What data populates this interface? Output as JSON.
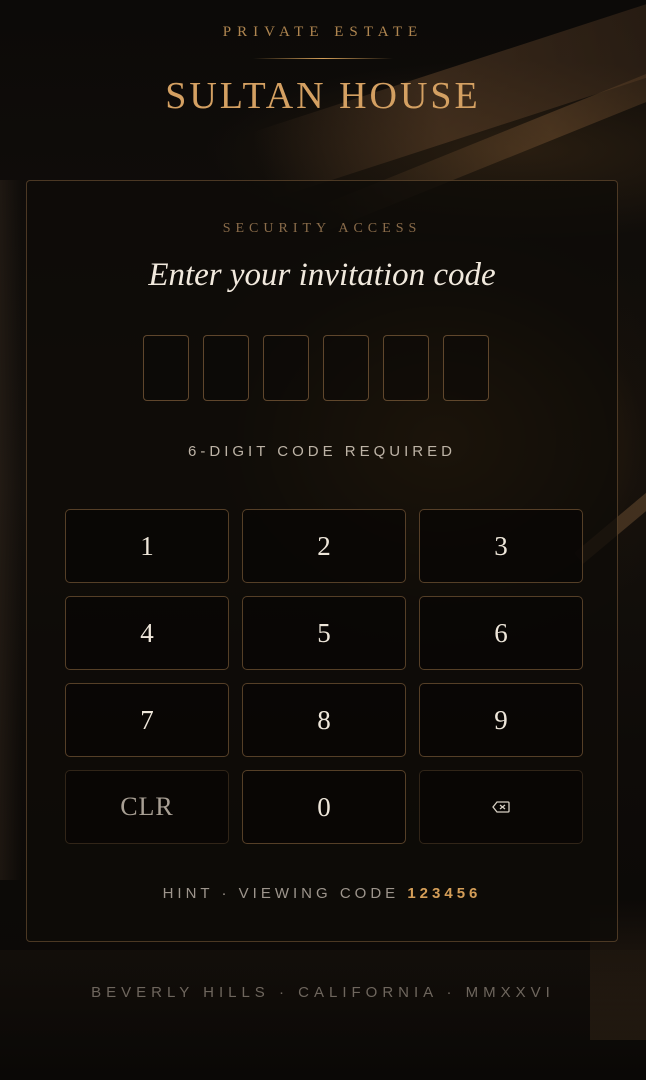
{
  "header": {
    "eyebrow": "PRIVATE ESTATE",
    "brand": "SULTAN HOUSE"
  },
  "card": {
    "eyebrow": "SECURITY ACCESS",
    "title": "Enter your invitation code",
    "code_slots": [
      "",
      "",
      "",
      "",
      "",
      ""
    ],
    "code_note": "6-DIGIT CODE REQUIRED"
  },
  "keypad": {
    "keys": [
      "1",
      "2",
      "3",
      "4",
      "5",
      "6",
      "7",
      "8",
      "9",
      "CLR",
      "0"
    ],
    "backspace_icon": "backspace-icon"
  },
  "hint": {
    "label": "HINT · VIEWING CODE",
    "code": "123456"
  },
  "footer": {
    "text": "BEVERLY HILLS · CALIFORNIA · MMXXVI"
  },
  "colors": {
    "accent_gold": "#d4a062",
    "hint_gold": "#d49e58",
    "background": "#0a0806"
  }
}
